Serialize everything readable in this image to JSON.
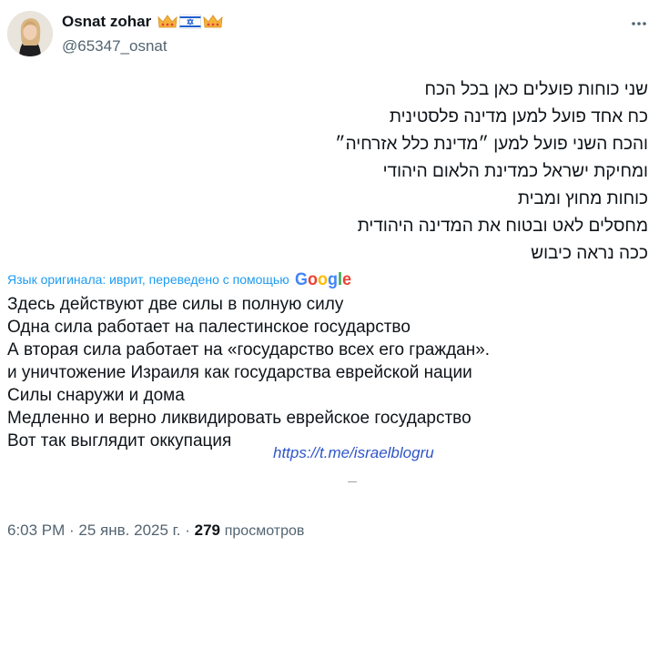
{
  "author": {
    "display_name": "Osnat zohar",
    "handle": "@65347_osnat",
    "name_emojis": [
      "crown-icon",
      "israel-flag-icon",
      "crown-icon"
    ]
  },
  "tweet": {
    "original_lines": [
      "שני כוחות פועלים כאן בכל הכח",
      "כח אחד פועל למען מדינה פלסטינית",
      "והכח השני פועל למען ״מדינת כלל אזרחיה״",
      "ומחיקת ישראל כמדינת הלאום היהודי",
      "כוחות מחוץ ומבית",
      "מחסלים לאט ובטוח את המדינה היהודית",
      "ככה נראה כיבוש"
    ],
    "translation_note": "Язык оригинала: иврит, переведено с помощью",
    "translation_provider": "Google",
    "translated_lines": [
      "Здесь действуют две силы в полную силу",
      "Одна сила работает на палестинское государство",
      "А вторая сила работает на «государство всех его граждан».",
      "и уничтожение Израиля как государства еврейской нации",
      "Силы снаружи и дома",
      "Медленно и верно ликвидировать еврейское государство",
      "Вот так выглядит оккупация"
    ],
    "link": "https://t.me/israelblogru"
  },
  "meta": {
    "time": "6:03 PM",
    "date": "25 янв. 2025 г.",
    "separator": " · ",
    "views_count": "279",
    "views_label": "просмотров"
  },
  "colors": {
    "accent": "#1d9bf0",
    "secondary_text": "#536471",
    "link": "#2f55c9"
  }
}
